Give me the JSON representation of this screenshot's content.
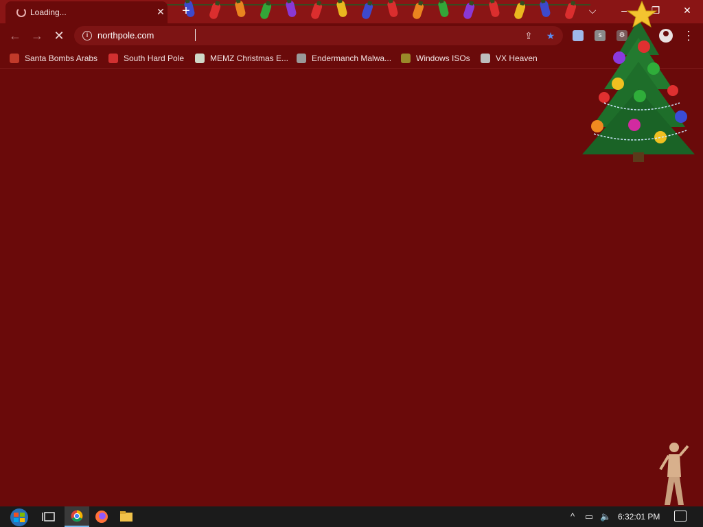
{
  "tab": {
    "title": "Loading...",
    "close_glyph": "✕"
  },
  "new_tab_glyph": "+",
  "window_controls": {
    "tab_list_glyph": "⌵",
    "minimize_glyph": "–",
    "restore_glyph": "❐",
    "close_glyph": "✕"
  },
  "nav": {
    "back_glyph": "←",
    "forward_glyph": "→",
    "stop_glyph": "✕"
  },
  "address": {
    "url": "northpole.com",
    "info_glyph": "i"
  },
  "omnibox_icons": {
    "share_glyph": "⇪",
    "star_glyph": "★"
  },
  "extensions": [
    {
      "icon": "flag-extension-icon",
      "color": "#9fb8e8",
      "glyph": ""
    },
    {
      "icon": "s-extension-icon",
      "color": "#8a8a8a",
      "glyph": "s"
    },
    {
      "icon": "puzzle-extension-icon",
      "color": "#7a5a5a",
      "glyph": "⚙"
    }
  ],
  "menu_glyph": "⋮",
  "bookmarks": [
    {
      "label": "Santa Bombs Arabs",
      "icon": "santa-icon",
      "color": "#c23a2a"
    },
    {
      "label": "South Hard Pole",
      "icon": "snowflake-icon",
      "color": "#d23030"
    },
    {
      "label": "MEMZ Christmas E...",
      "icon": "memz-icon",
      "color": "#cfd8c8"
    },
    {
      "label": "Endermanch Malwa...",
      "icon": "raccoon-icon",
      "color": "#9a9a9a"
    },
    {
      "label": "Windows ISOs",
      "icon": "tree-bookmark-icon",
      "color": "#9a8a2a"
    },
    {
      "label": "VX Heaven",
      "icon": "vx-icon",
      "color": "#bdbdbd"
    }
  ],
  "taskbar": {
    "time": "6:32:01 PM",
    "tray_up_glyph": "^",
    "network_glyph": "▭",
    "volume_glyph": "🔈"
  },
  "colors": {
    "page_background": "#6a0a0a",
    "titlebar": "#8a1515",
    "taskbar": "#1b1b1b",
    "bulbs": [
      "#3a4cd6",
      "#e03030",
      "#f08a20",
      "#2fae3a",
      "#8a3adf",
      "#e03030",
      "#f0c020"
    ]
  }
}
